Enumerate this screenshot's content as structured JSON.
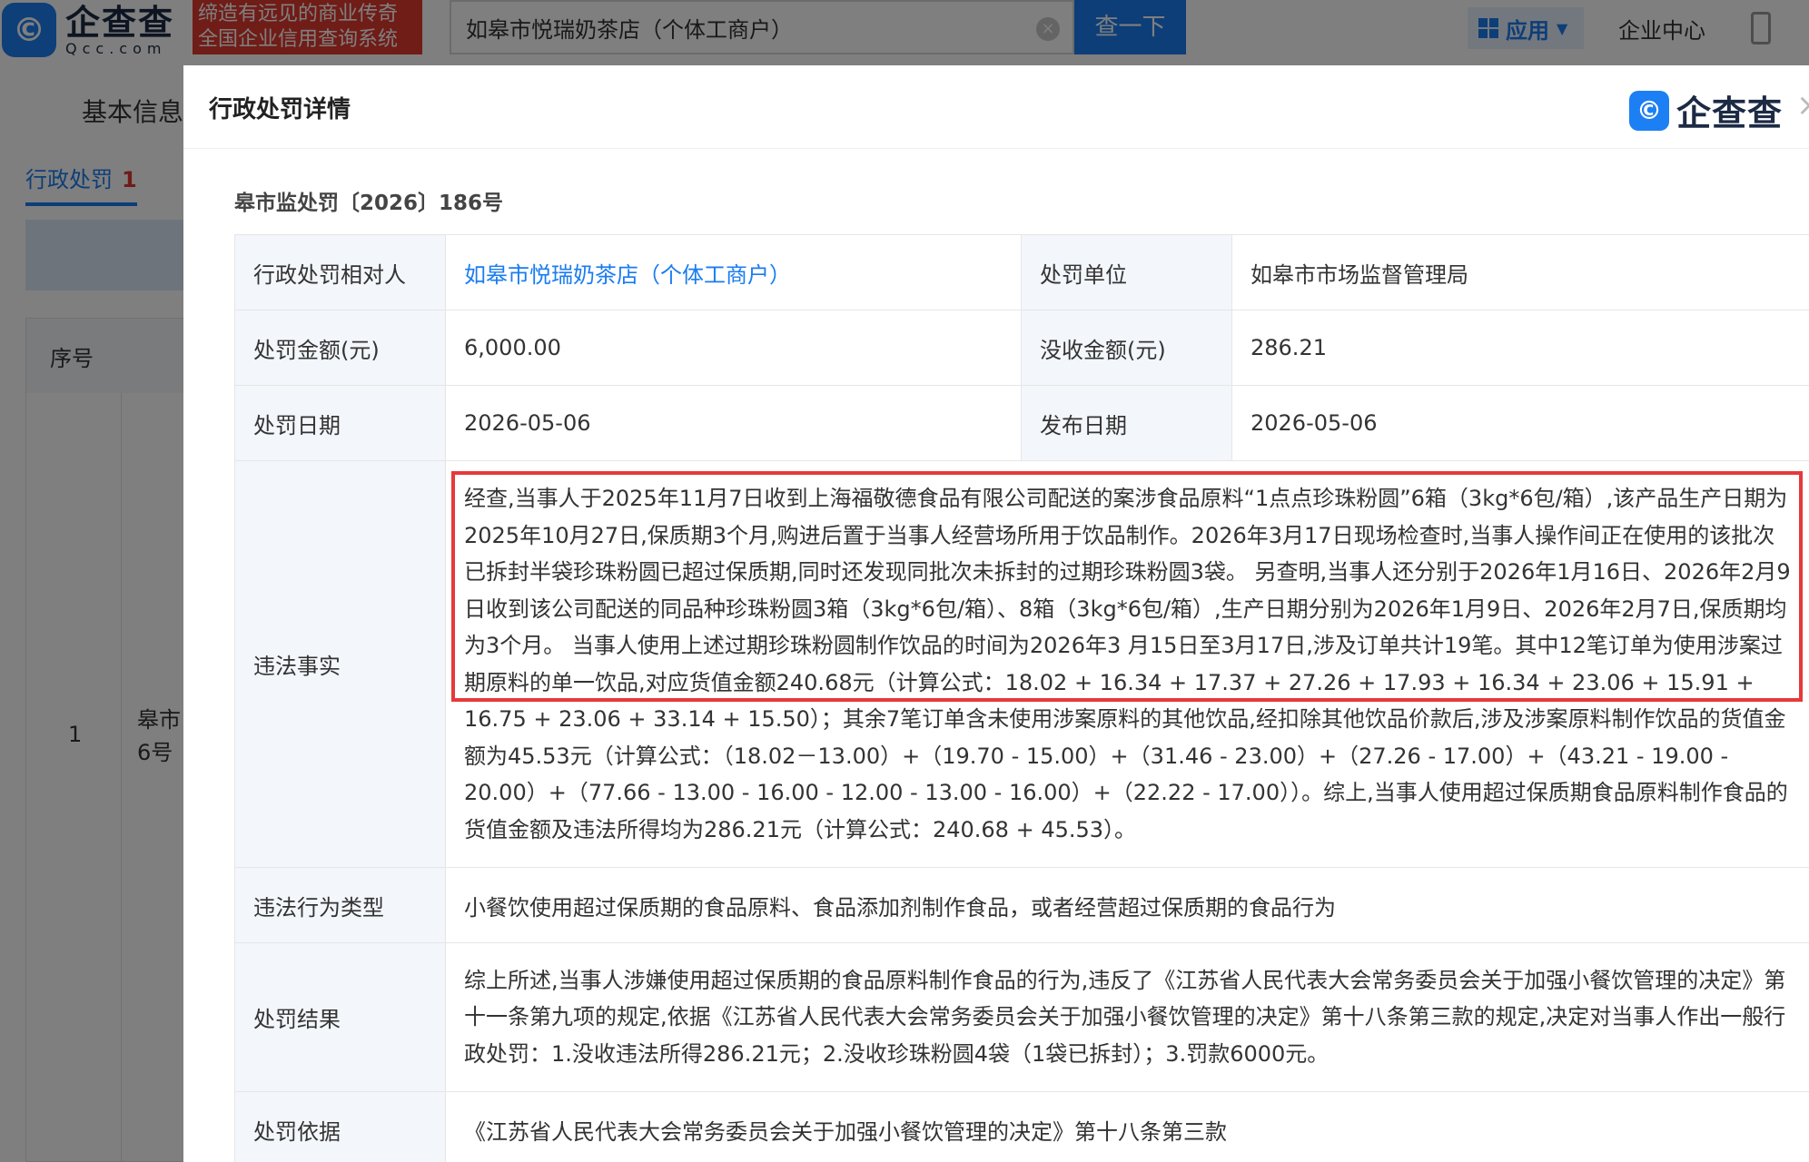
{
  "topbar": {
    "logo_cn": "企查查",
    "logo_en": "Qcc.com",
    "slogan_line1": "缔造有远见的商业传奇",
    "slogan_line2": "全国企业信用查询系统",
    "search_value": "如皋市悦瑞奶茶店（个体工商户）",
    "search_button": "查一下",
    "apps_label": "应用",
    "enterprise_center": "企业中心"
  },
  "background_page": {
    "tab_basic": "基本信息",
    "subtab_label": "行政处罚",
    "subtab_count": "1",
    "table_header": "序号",
    "row_index": "1",
    "row_name": "皋市",
    "row_name2": "6号"
  },
  "modal": {
    "title": "行政处罚详情",
    "brand": "企查查",
    "case_number": "皋市监处罚〔2026〕186号",
    "rows": {
      "party_label": "行政处罚相对人",
      "party_value": "如皋市悦瑞奶茶店（个体工商户）",
      "unit_label": "处罚单位",
      "unit_value": "如皋市市场监督管理局",
      "amount_label": "处罚金额(元)",
      "amount_value": "6,000.00",
      "confiscate_label": "没收金额(元)",
      "confiscate_value": "286.21",
      "date_label": "处罚日期",
      "date_value": "2026-05-06",
      "publish_label": "发布日期",
      "publish_value": "2026-05-06",
      "facts_label": "违法事实",
      "facts_highlighted": "经查,当事人于2025年11月7日收到上海福敬德食品有限公司配送的案涉食品原料“1点点珍珠粉圆”6箱（3kg*6包/箱）,该产品生产日期为2025年10月27日,保质期3个月,购进后置于当事人经营场所用于饮品制作。2026年3月17日现场检查时,当事人操作间正在使用的该批次已拆封半袋珍珠粉圆已超过保质期,同时还发现同批次未拆封的过期珍珠粉圆3袋。 另查明,当事人还分别于2026年1月16日、2026年2月9日收到该公司配送的同品种珍珠粉圆3箱（3kg*6包/箱）、8箱（3kg*6包/箱）,生产日期分别为2026年1月9日、2026年2月7日,保质期均为3个月。 当事人使用上述过期珍珠粉圆制作饮品的时间为2026年3 月15日至3月17日,涉及订单共计19笔。其中12笔订单为使用涉案过期原料的单一饮品,对应货值金额240.68元（计算公式：18.02 + 16.34 + 17.37 + 27.26 + 17.9",
      "facts_rest": "3 + 16.34 + 23.06 + 15.91 + 16.75 + 23.06 + 33.14 + 15.50）；其余7笔订单含未使用涉案原料的其他饮品,经扣除其他饮品价款后,涉及涉案原料制作饮品的货值金额为45.53元（计算公式：（18.02－13.00）+（19.70 - 15.00）+（31.46 - 23.00）+（27.26 - 17.00）+（43.21 - 19.00 - 20.00）+（77.66 - 13.00 - 16.00 - 12.00 - 13.00 - 16.00）+（22.22 - 17.00））。综上,当事人使用超过保质期食品原料制作食品的货值金额及违法所得均为286.21元（计算公式：240.68 + 45.53）。",
      "type_label": "违法行为类型",
      "type_value": "小餐饮使用超过保质期的食品原料、食品添加剂制作食品，或者经营超过保质期的食品行为",
      "result_label": "处罚结果",
      "result_value": "综上所述,当事人涉嫌使用超过保质期的食品原料制作食品的行为,违反了《江苏省人民代表大会常务委员会关于加强小餐饮管理的决定》第十一条第九项的规定,依据《江苏省人民代表大会常务委员会关于加强小餐饮管理的决定》第十八条第三款的规定,决定对当事人作出一般行政处罚：1.没收违法所得286.21元；2.没收珍珠粉圆4袋（1袋已拆封）；3.罚款6000元。",
      "basis_label": "处罚依据",
      "basis_value": "《江苏省人民代表大会常务委员会关于加强小餐饮管理的决定》第十八条第三款"
    }
  },
  "colors": {
    "brand_blue": "#1a7cf0",
    "highlight_red": "#e53a3a",
    "slogan_red": "#e0382e"
  }
}
